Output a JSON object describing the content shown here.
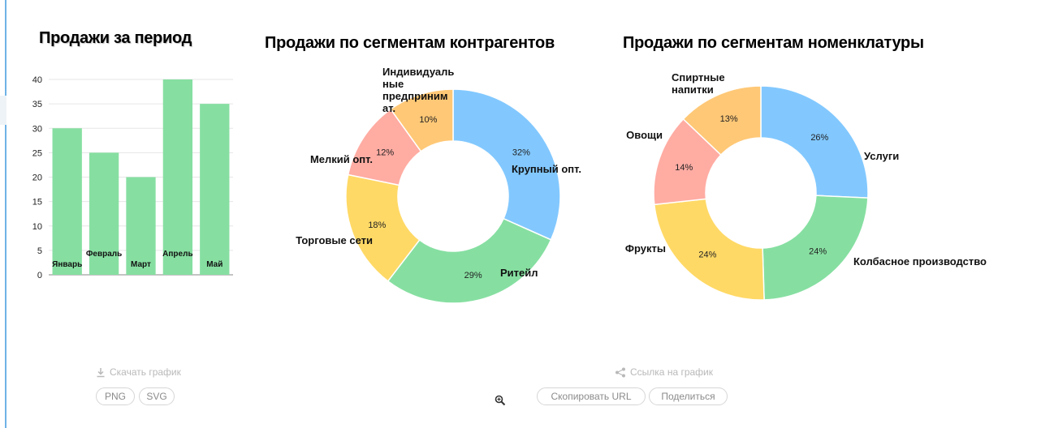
{
  "download": {
    "label": "Скачать график",
    "icon": "download-icon",
    "png_label": "PNG",
    "svg_label": "SVG"
  },
  "link": {
    "label": "Ссылка на график",
    "icon": "share-icon",
    "copy_label": "Скопировать URL",
    "share_label": "Поделиться"
  },
  "colors": {
    "bar": "#86dfa1",
    "blue": "#82c8ff",
    "green": "#86dfa1",
    "yellow": "#ffd966",
    "pink": "#ffaca3",
    "orange": "#ffc876"
  },
  "chart_data": [
    {
      "type": "bar",
      "title": "Продажи за период",
      "categories": [
        "Январь",
        "Февраль",
        "Март",
        "Апрель",
        "Май"
      ],
      "values": [
        30,
        25,
        20,
        40,
        35
      ],
      "ylim": [
        0,
        40
      ],
      "yticks": [
        0,
        5,
        10,
        15,
        20,
        25,
        30,
        35,
        40
      ],
      "grid": true
    },
    {
      "type": "pie",
      "title": "Продажи по сегментам контрагентов",
      "categories": [
        "Крупный опт.",
        "Ритейл",
        "Торговые сети",
        "Мелкий опт.",
        "Индивидуаль ные предприним ат."
      ],
      "values": [
        32,
        29,
        18,
        12,
        10
      ],
      "labels": [
        "32%",
        "29%",
        "18%",
        "12%",
        "10%"
      ],
      "colors": [
        "#82c8ff",
        "#86dfa1",
        "#ffd966",
        "#ffaca3",
        "#ffc876"
      ]
    },
    {
      "type": "pie",
      "title": "Продажи по сегментам номенклатуры",
      "categories": [
        "Услуги",
        "Колбасное производство",
        "Фрукты",
        "Овощи",
        "Спиртные напитки"
      ],
      "values": [
        26,
        24,
        24,
        14,
        13
      ],
      "labels": [
        "26%",
        "24%",
        "24%",
        "14%",
        "13%"
      ],
      "colors": [
        "#82c8ff",
        "#86dfa1",
        "#ffd966",
        "#ffaca3",
        "#ffc876"
      ]
    }
  ]
}
